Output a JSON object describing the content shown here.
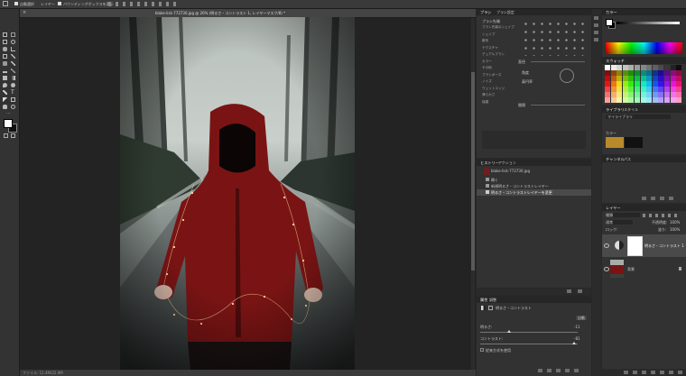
{
  "optbar": {
    "label1": "自動選択",
    "label2": "レイヤー",
    "label3": "バウンディングボックスを表示"
  },
  "document": {
    "tab_title": "blake-lisk-772730.jpg @ 26% (明るさ・コントラスト 1, レイヤーマスク/8) *",
    "status": "ファイル: 11.4M/22.9M"
  },
  "brushes": {
    "tab1": "ブラシ",
    "tab2": "ブラシ設定",
    "title": "ブラシ先端",
    "items": [
      "ブラシ先端のシェイプ",
      "シェイプ",
      "散布",
      "テクスチャ",
      "デュアルブラシ",
      "カラー",
      "その他",
      "ブラシポーズ",
      "ノイズ",
      "ウェットエッジ",
      "滑らかさ",
      "保護"
    ],
    "label_size": "直径",
    "label_angle": "角度",
    "label_round": "真円率",
    "label_spacing": "間隔"
  },
  "history": {
    "tab1": "ヒストリー",
    "tab2": "アクション",
    "snapshot": "blake-lisk-772730.jpg",
    "items": [
      "開く",
      "新規明るさ・コントラストレイヤー",
      "明るさ・コントラストレイヤーを変更"
    ]
  },
  "properties": {
    "tab1": "属性",
    "tab2": "調整",
    "adj_title": "明るさ・コントラスト",
    "auto": "自動",
    "brightness_label": "明るさ:",
    "brightness_value": "-11",
    "contrast_label": "コントラスト:",
    "contrast_value": "-81",
    "legacy": "従来方式を使用"
  },
  "color": {
    "tab1": "カラー",
    "swatches_tab": "スウォッチ",
    "fg": "#ffffff",
    "bg": "#000000"
  },
  "libraries": {
    "tab1": "ライブラリ",
    "tab2": "スタイル",
    "library_name": "マイライブラリ",
    "section": "カラー",
    "colors": [
      "#b88a2a",
      "#111111"
    ]
  },
  "channels": {
    "tab1": "チャンネル",
    "tab2": "パス"
  },
  "layers": {
    "tab": "レイヤー",
    "kind": "種類",
    "mode": "通常",
    "opacity_label": "不透明度:",
    "opacity_value": "100%",
    "lock_label": "ロック:",
    "fill_label": "塗り:",
    "fill_value": "100%",
    "items": [
      {
        "name": "明るさ・コントラスト 1"
      },
      {
        "name": "背景"
      }
    ]
  }
}
